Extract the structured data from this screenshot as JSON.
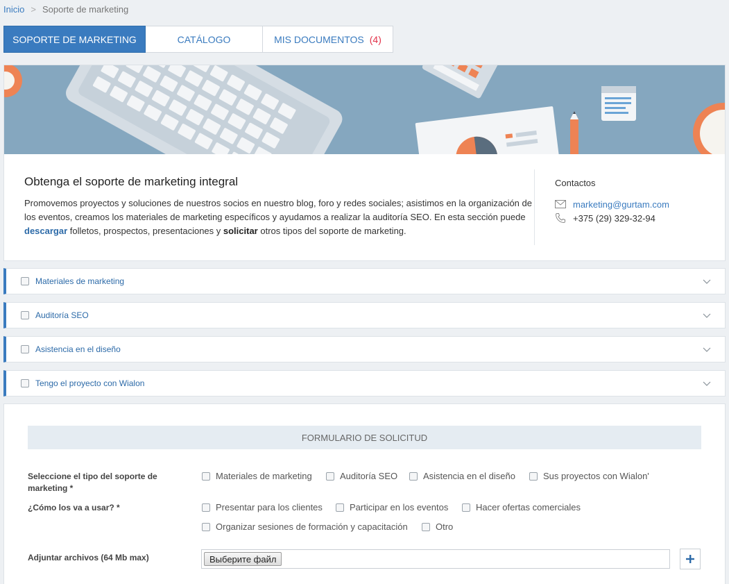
{
  "breadcrumb": {
    "home": "Inicio",
    "separator": ">",
    "current": "Soporte de marketing"
  },
  "tabs": [
    {
      "label": "Soporte de marketing",
      "active": true
    },
    {
      "label": "Catálogo",
      "active": false
    },
    {
      "label": "Mis documentos",
      "badge": "(4)",
      "active": false
    }
  ],
  "intro": {
    "title": "Obtenga el soporte de marketing integral",
    "text_1": "Promovemos proyectos y soluciones de nuestros socios en nuestro blog, foro y redes sociales; asistimos en la organización de los eventos, creamos los materiales de marketing específicos y ayudamos a realizar la auditoría SEO. En esta sección puede ",
    "link_download": "descargar",
    "text_2": " folletos, prospectos, presentaciones y ",
    "link_request": "solicitar",
    "text_3": " otros tipos del soporte de marketing."
  },
  "contacts": {
    "title": "Contactos",
    "email": "marketing@gurtam.com",
    "phone": "+375 (29) 329-32-94"
  },
  "accordion": [
    {
      "label": "Materiales de marketing"
    },
    {
      "label": "Auditoría SEO"
    },
    {
      "label": "Asistencia en el diseño"
    },
    {
      "label": "Tengo el proyecto con Wialon"
    }
  ],
  "form": {
    "title": "Formulario de solicitud",
    "support_type": {
      "label": "Seleccione el tipo del soporte de marketing *",
      "options": [
        "Materiales de marketing",
        "Auditoría SEO",
        "Asistencia en el diseño",
        "Sus proyectos con Wialon'"
      ]
    },
    "usage": {
      "label": "¿Cómo los va a usar? *",
      "options": [
        "Presentar para los clientes",
        "Participar en los eventos",
        "Hacer ofertas comerciales",
        "Organizar sesiones de formación y capacitación",
        "Otro"
      ]
    },
    "attach": {
      "label": "Adjuntar archivos (64 Mb max)",
      "button": "Выберите файл"
    }
  },
  "colors": {
    "primary": "#3a7bbf",
    "badge": "#e2334a",
    "banner": "#85a7bf",
    "accent_orange": "#ee8354"
  }
}
